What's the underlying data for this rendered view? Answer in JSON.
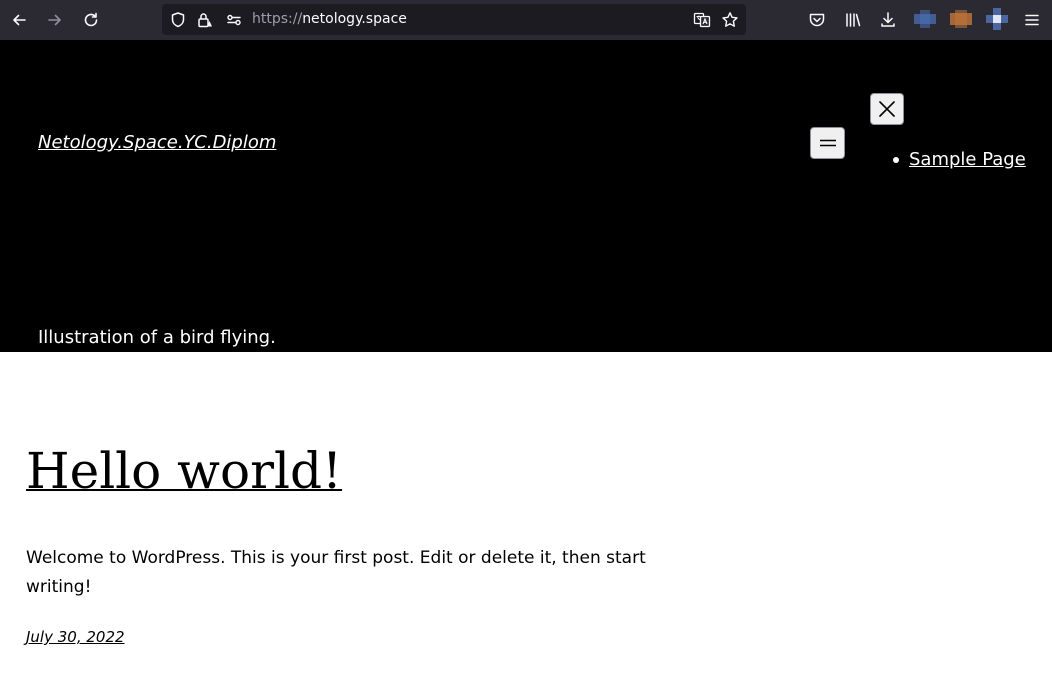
{
  "browser": {
    "url_scheme": "https://",
    "url_host": "netology.space",
    "profile_colors": [
      "#4a6fb5",
      "#c2773a",
      "#5c7fd0"
    ]
  },
  "header": {
    "site_title": "Netology.Space.YC.Diplom",
    "nav_items": [
      {
        "label": "Sample Page"
      }
    ],
    "image_caption": "Illustration of a bird flying."
  },
  "post": {
    "title": "Hello world!",
    "excerpt": "Welcome to WordPress. This is your first post. Edit or delete it, then start writing!",
    "date": "July 30, 2022"
  }
}
